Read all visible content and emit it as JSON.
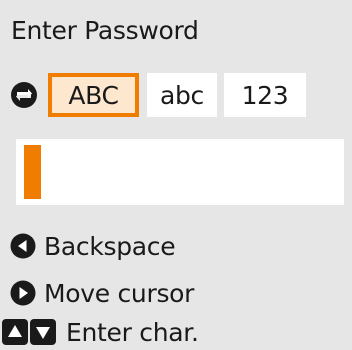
{
  "screen": {
    "title": "Enter Password"
  },
  "mode_selector": {
    "cycle_icon": "switch-mode-icon",
    "modes": [
      {
        "label": "ABC",
        "selected": true
      },
      {
        "label": "abc",
        "selected": false
      },
      {
        "label": "123",
        "selected": false
      }
    ]
  },
  "password_input": {
    "value": ""
  },
  "help": {
    "backspace_label": "Backspace",
    "move_cursor_label": "Move cursor",
    "enter_char_label": "Enter char."
  },
  "colors": {
    "accent": "#f07d00",
    "background": "#e6e6e6",
    "field": "#ffffff",
    "text": "#1a1a1a"
  }
}
